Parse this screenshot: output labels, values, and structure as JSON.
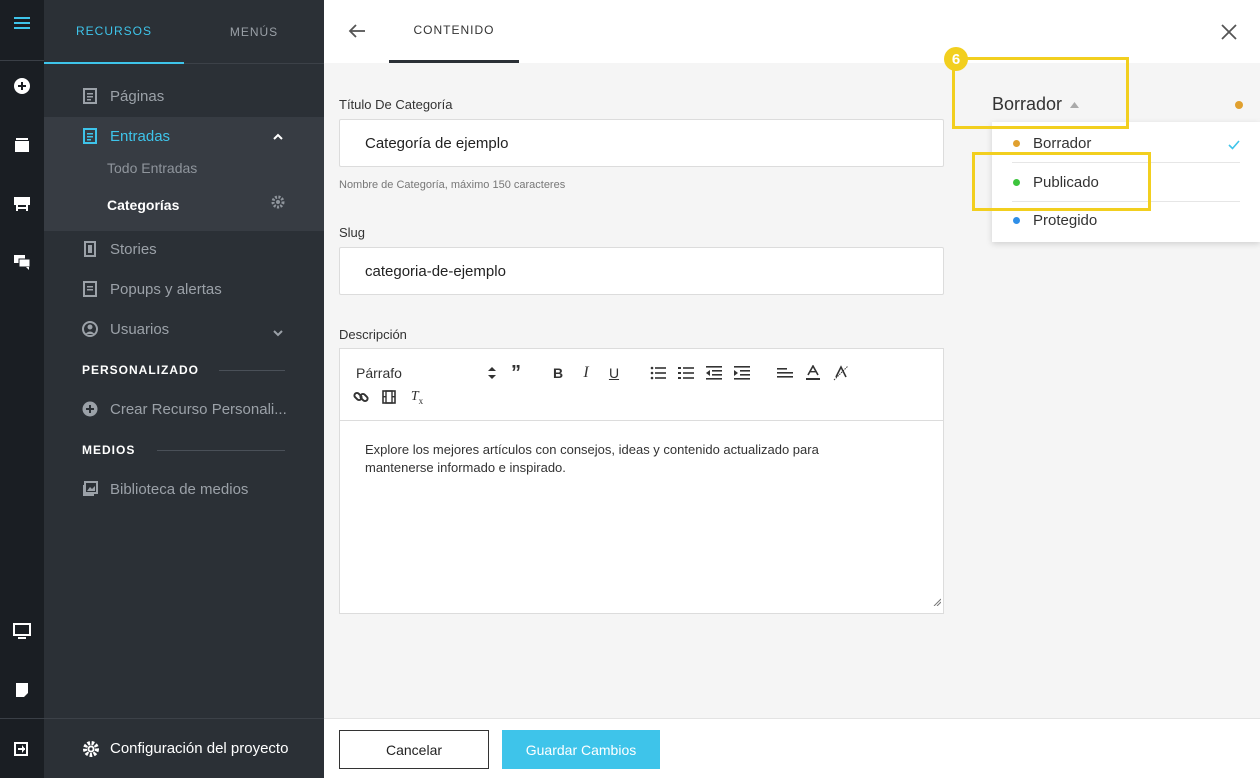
{
  "rail": {
    "icons": [
      "menu-icon",
      "add-circle-icon",
      "layers-icon",
      "presentation-icon",
      "chat-icon",
      "monitor-icon",
      "note-icon",
      "logout-icon"
    ]
  },
  "sidebar": {
    "tabs": [
      {
        "label": "RECURSOS",
        "active": true
      },
      {
        "label": "MENÚS",
        "active": false
      }
    ],
    "items": [
      {
        "label": "Páginas"
      },
      {
        "label": "Entradas"
      },
      {
        "label": "Stories"
      },
      {
        "label": "Popups y alertas"
      },
      {
        "label": "Usuarios"
      }
    ],
    "sub_items": [
      {
        "label": "Todo Entradas"
      },
      {
        "label": "Categorías"
      }
    ],
    "section_custom": "PERSONALIZADO",
    "custom_item": "Crear Recurso Personali...",
    "section_media": "MEDIOS",
    "media_item": "Biblioteca de medios",
    "footer": "Configuración del proyecto"
  },
  "topbar": {
    "tab": "CONTENIDO"
  },
  "form": {
    "title_label": "Título De Categoría",
    "title_value": "Categoría de ejemplo",
    "title_hint": "Nombre de Categoría, máximo 150 caracteres",
    "slug_label": "Slug",
    "slug_value": "categoria-de-ejemplo",
    "desc_label": "Descripción",
    "format_select": "Párrafo",
    "desc_text": "Explore los mejores artículos con consejos, ideas y contenido actualizado para mantenerse informado e inspirado."
  },
  "status": {
    "current": "Borrador",
    "options": [
      {
        "label": "Borrador",
        "color": "#e0a02f",
        "selected": true
      },
      {
        "label": "Publicado",
        "color": "#3cc43c",
        "selected": false
      },
      {
        "label": "Protegido",
        "color": "#2f8fe8",
        "selected": false
      }
    ],
    "badge": "6"
  },
  "buttons": {
    "cancel": "Cancelar",
    "save": "Guardar Cambios"
  },
  "colors": {
    "accent": "#3ec4ea",
    "highlight": "#f2cf1f",
    "sidebar_bg": "#2b3036",
    "rail_bg": "#1a1e23"
  }
}
